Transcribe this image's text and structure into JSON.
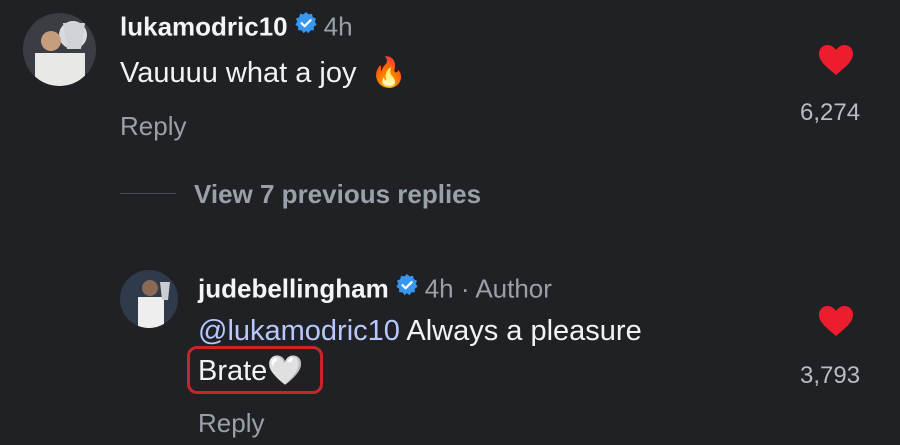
{
  "comment": {
    "username": "lukamodric10",
    "time": "4h",
    "text": "Vauuuu what a joy",
    "emoji": "🔥",
    "reply_label": "Reply",
    "like_count": "6,274"
  },
  "thread": {
    "view_previous_label": "View 7 previous replies"
  },
  "reply": {
    "username": "judebellingham",
    "time": "4h",
    "separator": "·",
    "author_badge": "Author",
    "mention": "@lukamodric10",
    "text_line1": " Always a pleasure",
    "text_line2": "Brate",
    "emoji": "🤍",
    "reply_label": "Reply",
    "like_count": "3,793"
  },
  "colors": {
    "background": "#1f2125",
    "heart": "#ee1d2e",
    "verified": "#3897f0",
    "highlight": "#c8252a"
  }
}
